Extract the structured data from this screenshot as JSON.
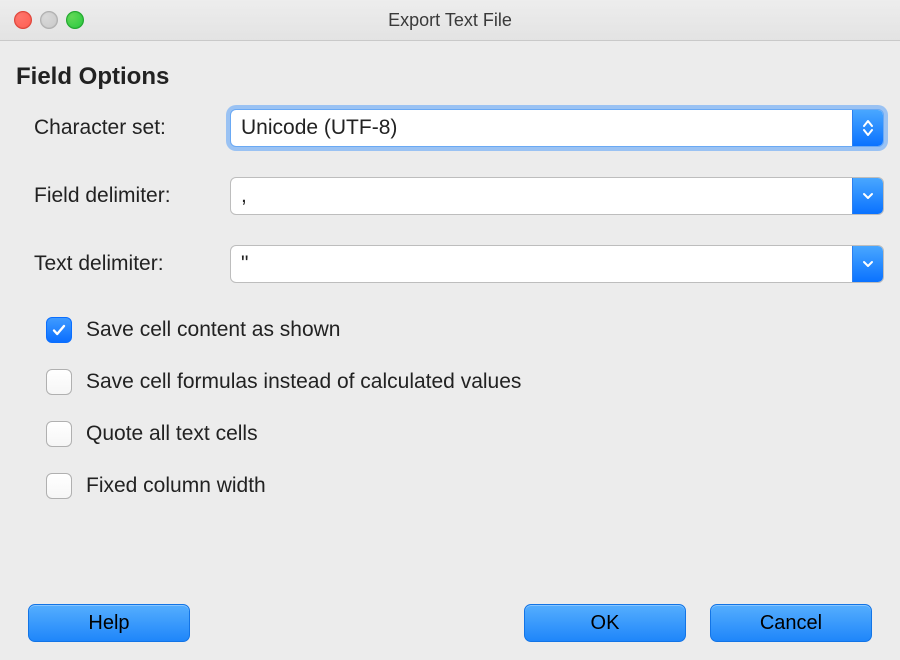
{
  "window": {
    "title": "Export Text File"
  },
  "section": {
    "title": "Field Options"
  },
  "fields": {
    "charset": {
      "label": "Character set:",
      "value": "Unicode (UTF-8)"
    },
    "field_delimiter": {
      "label": "Field delimiter:",
      "value": ","
    },
    "text_delimiter": {
      "label": "Text delimiter:",
      "value": "\""
    }
  },
  "checkboxes": {
    "save_as_shown": {
      "label": "Save cell content as shown",
      "checked": true
    },
    "save_formulas": {
      "label": "Save cell formulas instead of calculated values",
      "checked": false
    },
    "quote_all": {
      "label": "Quote all text cells",
      "checked": false
    },
    "fixed_width": {
      "label": "Fixed column width",
      "checked": false
    }
  },
  "buttons": {
    "help": "Help",
    "ok": "OK",
    "cancel": "Cancel"
  }
}
